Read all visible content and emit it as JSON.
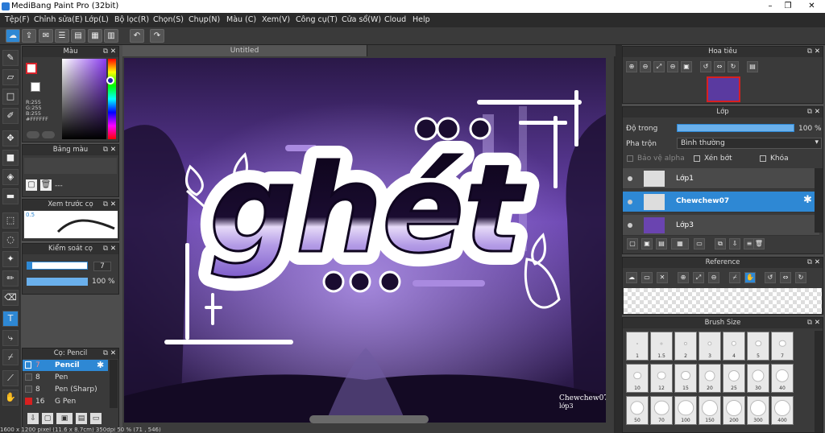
{
  "window": {
    "title": "MediBang Paint Pro (32bit)"
  },
  "menu": [
    "Tệp(F)",
    "Chỉnh sửa(E)",
    "Lớp(L)",
    "Bộ lọc(R)",
    "Chọn(S)",
    "Chụp(N)",
    "Màu (C)",
    "Xem(V)",
    "Công cụ(T)",
    "Cửa sổ(W)",
    "Cloud",
    "Help"
  ],
  "document": {
    "tab_title": "Untitled",
    "watermark": "Chewchew07\nlớp3"
  },
  "color_panel": {
    "title": "Màu",
    "r": "R:255",
    "g": "G:255",
    "b": "B:255",
    "hex": "#FFFFFF",
    "primary": "#ffffff",
    "accent": "#d8242c"
  },
  "palette_panel": {
    "title": "Bảng màu",
    "value": "---"
  },
  "brush_preview_panel": {
    "title": "Xem trước cọ",
    "size": "0.5"
  },
  "brush_control_panel": {
    "title": "Kiểm soát cọ",
    "size_value": "7",
    "opacity_value": "100 %"
  },
  "brush_list_panel": {
    "title": "Cọ: Pencil",
    "items": [
      {
        "size": "7",
        "name": "Pencil",
        "color": "#1e5aa8",
        "selected": true
      },
      {
        "size": "8",
        "name": "Pen",
        "color": "#444",
        "selected": false
      },
      {
        "size": "8",
        "name": "Pen (Sharp)",
        "color": "#444",
        "selected": false
      },
      {
        "size": "16",
        "name": "G Pen",
        "color": "#d82020",
        "selected": false
      }
    ]
  },
  "navigator_panel": {
    "title": "Hoa tiêu"
  },
  "layer_panel": {
    "title": "Lớp",
    "opacity_label": "Độ trong",
    "opacity_value": "100 %",
    "blend_label": "Pha trộn",
    "blend_value": "Bình thường",
    "protect_alpha": "Bảo vệ alpha",
    "clipping": "Xén bớt",
    "lock": "Khóa",
    "layers": [
      {
        "name": "Lớp1",
        "selected": false
      },
      {
        "name": "Chewchew07",
        "selected": true
      },
      {
        "name": "Lớp3",
        "selected": false
      }
    ]
  },
  "reference_panel": {
    "title": "Reference"
  },
  "brush_size_panel": {
    "title": "Brush Size",
    "row1": [
      "1",
      "1.5",
      "2",
      "3",
      "4",
      "5",
      "7"
    ],
    "row2": [
      "10",
      "12",
      "15",
      "20",
      "25",
      "30",
      "40"
    ],
    "row3": [
      "50",
      "70",
      "100",
      "150",
      "200",
      "300",
      "400"
    ]
  },
  "status": {
    "text": "1600 x 1200 pixel (11.6 x 8.7cm) 350dpi 50 % (71 , 546)"
  }
}
